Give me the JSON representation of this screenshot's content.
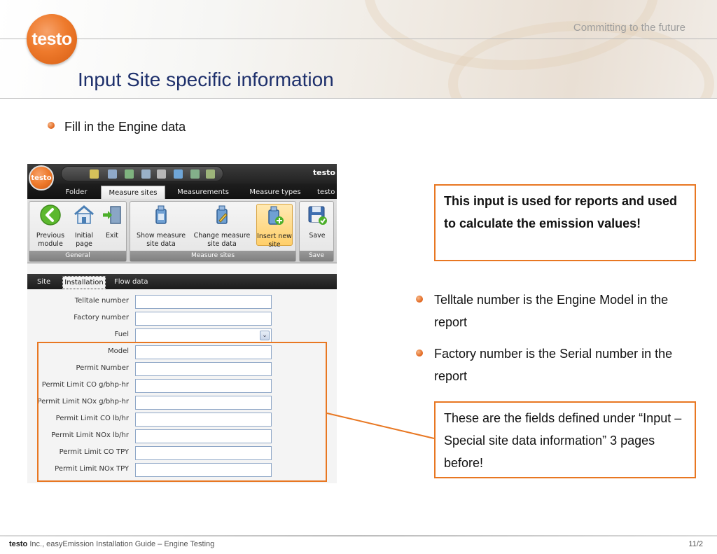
{
  "header": {
    "logo_text": "testo",
    "tagline": "Committing to the future",
    "title": "Input Site specific information"
  },
  "bullets_left": [
    {
      "text": "Fill in the Engine data"
    }
  ],
  "bullets_right": [
    {
      "text": "Telltale number is the Engine Model in the report"
    },
    {
      "text": "Factory number is the Serial number in the report"
    }
  ],
  "callouts": {
    "top": "This input is used for reports and used to calculate the emission values!",
    "bottom": "These are the fields defined under “Input – Special site data information” 3 pages before!"
  },
  "app": {
    "logo_text": "testo",
    "brand": "testo",
    "tabs": [
      {
        "label": "Folder"
      },
      {
        "label": "Measure sites"
      },
      {
        "label": "Measurements"
      },
      {
        "label": "Measure types"
      },
      {
        "label": "testo"
      }
    ],
    "ribbon": {
      "general": {
        "label": "General",
        "buttons": [
          {
            "label": "Previous module"
          },
          {
            "label": "Initial page"
          },
          {
            "label": "Exit"
          }
        ]
      },
      "measure_sites": {
        "label": "Measure sites",
        "buttons": [
          {
            "label": "Show measure site data"
          },
          {
            "label": "Change measure site data"
          },
          {
            "label": "Insert new site"
          }
        ]
      },
      "save": {
        "label": "Save",
        "buttons": [
          {
            "label": "Save"
          }
        ]
      }
    },
    "form_tabs": [
      {
        "label": "Site"
      },
      {
        "label": "Installation"
      },
      {
        "label": "Flow data"
      }
    ],
    "fields": [
      {
        "label": "Telltale number",
        "value": ""
      },
      {
        "label": "Factory number",
        "value": ""
      },
      {
        "label": "Fuel",
        "value": ""
      },
      {
        "label": "Model",
        "value": ""
      },
      {
        "label": "Permit Number",
        "value": ""
      },
      {
        "label": "Permit Limit CO g/bhp-hr",
        "value": ""
      },
      {
        "label": "Permit Limit NOx g/bhp-hr",
        "value": ""
      },
      {
        "label": "Permit Limit CO lb/hr",
        "value": ""
      },
      {
        "label": "Permit Limit NOx lb/hr",
        "value": ""
      },
      {
        "label": "Permit Limit CO TPY",
        "value": ""
      },
      {
        "label": "Permit Limit NOx TPY",
        "value": ""
      }
    ]
  },
  "footer": {
    "brand": "testo",
    "text": " Inc., easyEmission Installation Guide – Engine Testing",
    "page": "11/2"
  },
  "colors": {
    "accent": "#e87722",
    "title": "#1d2f6b"
  }
}
